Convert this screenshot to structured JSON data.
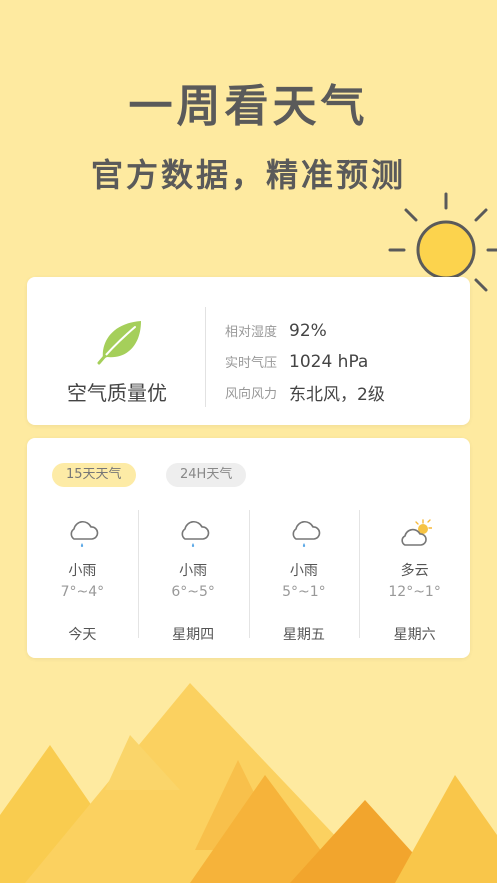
{
  "headline": {
    "title": "一周看天气",
    "subtitle": "官方数据，精准预测"
  },
  "air_card": {
    "air_quality_label": "空气质量优",
    "stats": [
      {
        "label": "相对湿度",
        "value": "92%"
      },
      {
        "label": "实时气压",
        "value": "1024 hPa"
      },
      {
        "label": "风向风力",
        "value": "东北风，2级"
      }
    ]
  },
  "forecast_card": {
    "tabs": [
      {
        "label": "15天天气",
        "active": true
      },
      {
        "label": "24H天气",
        "active": false
      }
    ],
    "days": [
      {
        "icon": "rain-cloud-icon",
        "condition": "小雨",
        "temp": "7°~4°",
        "day": "今天"
      },
      {
        "icon": "rain-cloud-icon",
        "condition": "小雨",
        "temp": "6°~5°",
        "day": "星期四"
      },
      {
        "icon": "rain-cloud-icon",
        "condition": "小雨",
        "temp": "5°~1°",
        "day": "星期五"
      },
      {
        "icon": "partly-cloudy-icon",
        "condition": "多云",
        "temp": "12°~1°",
        "day": "星期六"
      }
    ]
  },
  "colors": {
    "background": "#FEEAA0",
    "sun": "#FCD34D",
    "leaf": "#A5CF5A",
    "active_tab": "#FDEBA6"
  }
}
